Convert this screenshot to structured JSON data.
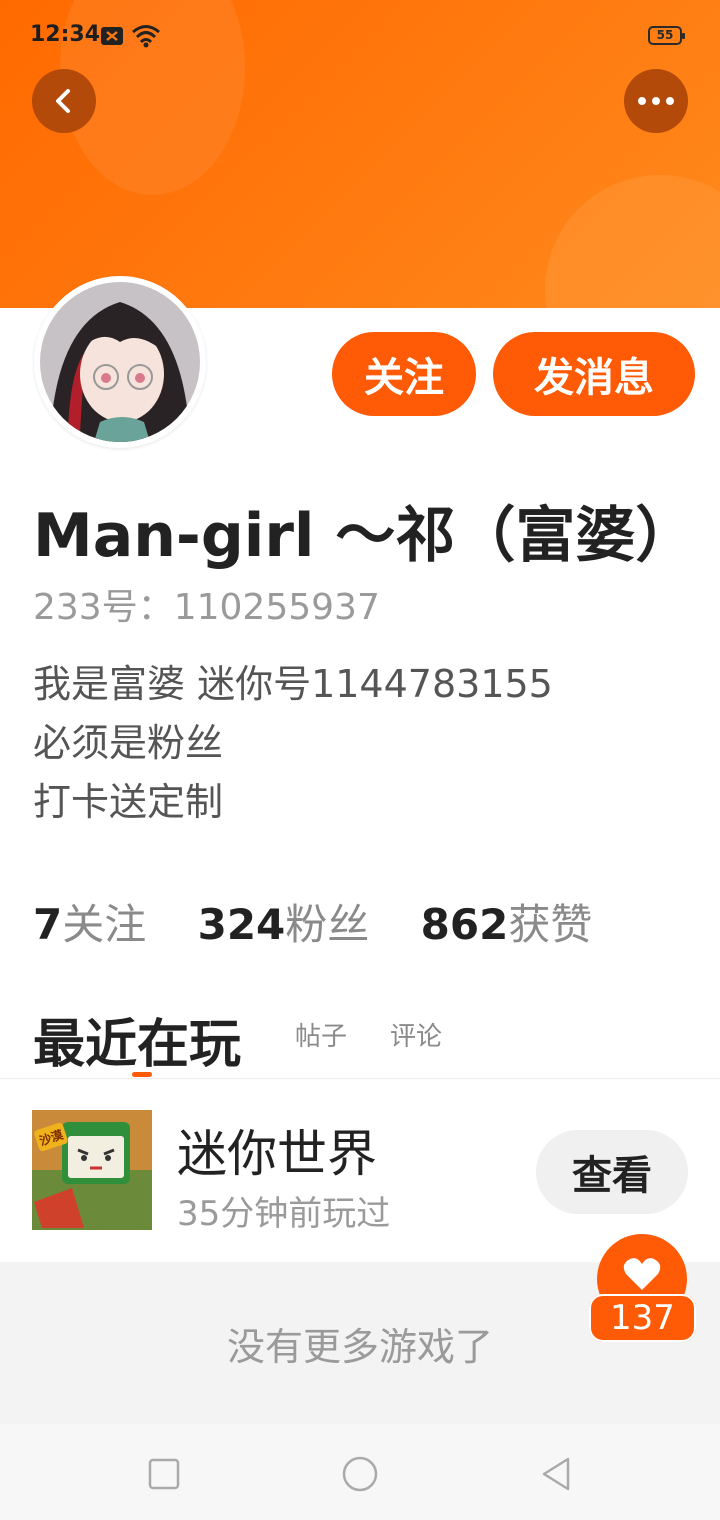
{
  "status_bar": {
    "time": "12:34",
    "battery": "55"
  },
  "header": {
    "back_icon": "chevron-left-icon",
    "more_icon": "more-dots-icon"
  },
  "actions": {
    "follow_label": "关注",
    "message_label": "发消息"
  },
  "profile": {
    "name": "Man-girl ～祁（富婆）",
    "uid": "233号：110255937",
    "bio_lines": [
      "我是富婆 迷你号1144783155",
      "必须是粉丝",
      "打卡送定制"
    ]
  },
  "stats": [
    {
      "count": "7",
      "label": "关注"
    },
    {
      "count": "324",
      "label": "粉丝"
    },
    {
      "count": "862",
      "label": "获赞"
    }
  ],
  "tabs": {
    "active": "最近在玩",
    "posts": "帖子",
    "comments": "评论"
  },
  "game": {
    "title": "迷你世界",
    "subtitle": "35分钟前玩过",
    "view_label": "查看",
    "thumb_text": "沙漠"
  },
  "footer": {
    "no_more": "没有更多游戏了"
  },
  "like": {
    "count": "137"
  },
  "colors": {
    "accent": "#ff5a05",
    "banner": "#ff7a10"
  }
}
